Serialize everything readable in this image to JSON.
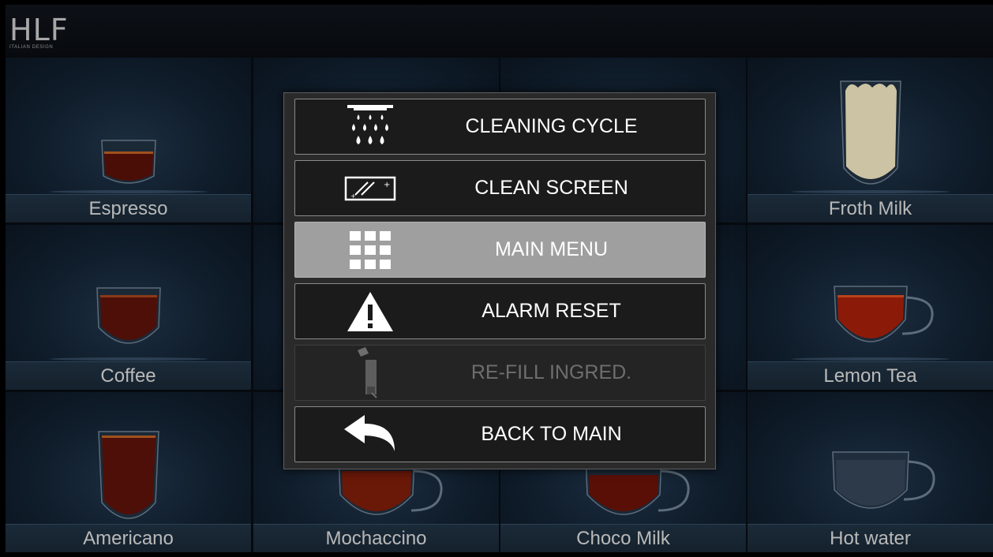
{
  "brand": {
    "logo": "HLF",
    "tagline": "ITALIAN DESIGN"
  },
  "drinks": [
    {
      "label": "Espresso",
      "icon": "espresso-cup-icon"
    },
    {
      "label": "Froth Milk",
      "icon": "froth-milk-glass-icon"
    },
    {
      "label": "Coffee",
      "icon": "coffee-cup-icon"
    },
    {
      "label": "Lemon Tea",
      "icon": "lemon-tea-cup-icon"
    },
    {
      "label": "Americano",
      "icon": "americano-glass-icon"
    },
    {
      "label": "Mochaccino",
      "icon": "mochaccino-cup-icon"
    },
    {
      "label": "Choco Milk",
      "icon": "choco-milk-cup-icon"
    },
    {
      "label": "Hot water",
      "icon": "hot-water-cup-icon"
    }
  ],
  "menu": {
    "items": [
      {
        "label": "CLEANING CYCLE",
        "icon": "cleaning-shower-icon",
        "state": "normal"
      },
      {
        "label": "CLEAN SCREEN",
        "icon": "clean-screen-icon",
        "state": "normal"
      },
      {
        "label": "MAIN MENU",
        "icon": "grid-menu-icon",
        "state": "selected"
      },
      {
        "label": "ALARM RESET",
        "icon": "warning-icon",
        "state": "normal"
      },
      {
        "label": "RE-FILL INGRED.",
        "icon": "refill-ingredient-icon",
        "state": "disabled"
      },
      {
        "label": "BACK TO MAIN",
        "icon": "back-arrow-icon",
        "state": "normal"
      }
    ]
  },
  "colors": {
    "popup_background": "#2a2a2a",
    "button_background": "#1b1b1b",
    "button_selected": "#9f9f9f",
    "coffee": "#5a1208",
    "froth_milk": "#c9c1a0"
  }
}
